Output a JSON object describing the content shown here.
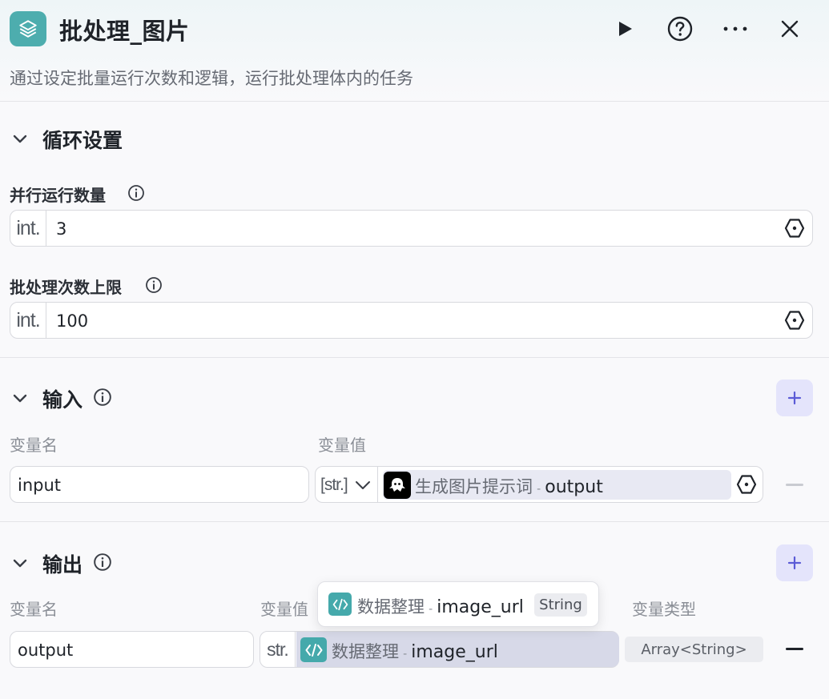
{
  "header": {
    "title": "批处理_图片",
    "subtitle": "通过设定批量运行次数和逻辑，运行批处理体内的任务",
    "node_icon": "layers-icon",
    "actions": [
      "play-icon",
      "help-icon",
      "more-icon",
      "close-icon"
    ]
  },
  "loop_settings": {
    "title": "循环设置",
    "parallel": {
      "label": "并行运行数量",
      "type": "int.",
      "value": "3"
    },
    "max_batch": {
      "label": "批处理次数上限",
      "type": "int.",
      "value": "100"
    }
  },
  "input_section": {
    "title": "输入",
    "col_name": "变量名",
    "col_value": "变量值",
    "row": {
      "name": "input",
      "type": "[str.]",
      "source_node": "生成图片提示词",
      "separator": "-",
      "source_var": "output"
    }
  },
  "output_section": {
    "title": "输出",
    "col_name": "变量名",
    "col_value": "变量值",
    "col_type": "变量类型",
    "row": {
      "name": "output",
      "type": "str.",
      "source_node": "数据整理",
      "separator": "-",
      "source_var": "image_url",
      "var_type": "Array<String>"
    }
  },
  "tooltip": {
    "source_node": "数据整理",
    "separator": "-",
    "source_var": "image_url",
    "type": "String"
  },
  "colors": {
    "accent": "#4dadae",
    "add_button_bg": "#e4e4fb",
    "add_button_fg": "#5b5bd6"
  }
}
